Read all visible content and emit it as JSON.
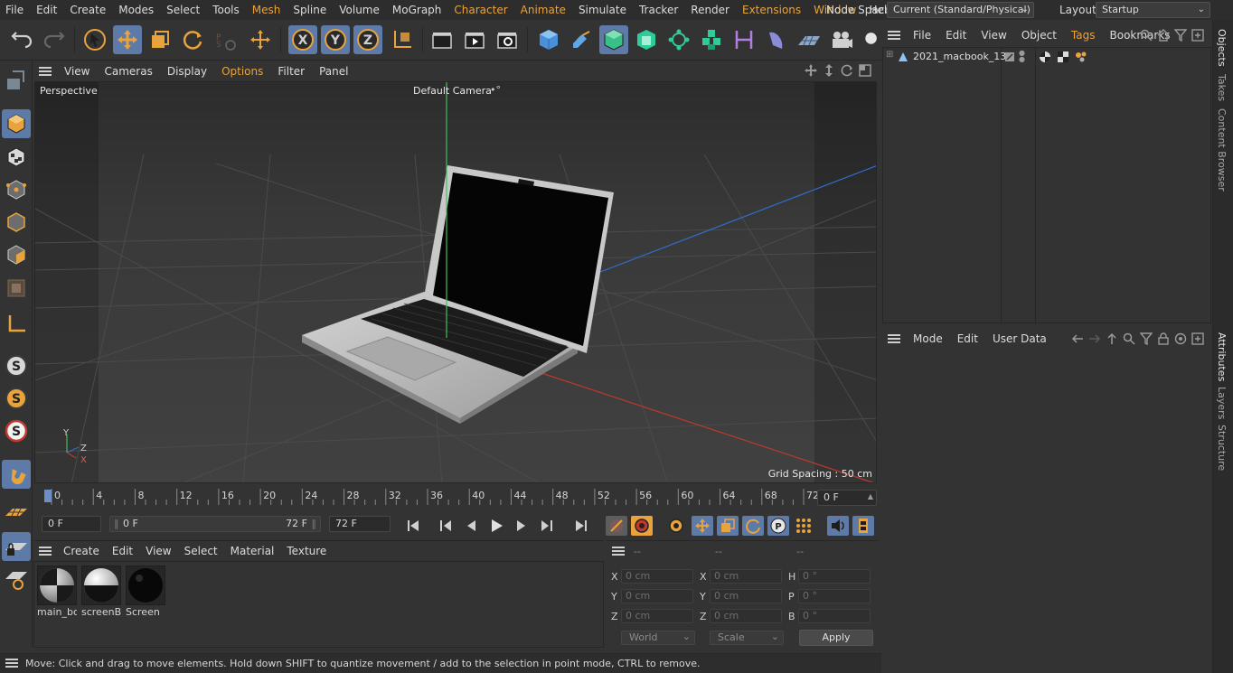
{
  "menu": {
    "items": [
      {
        "label": "File",
        "accent": false
      },
      {
        "label": "Edit",
        "accent": false
      },
      {
        "label": "Create",
        "accent": false
      },
      {
        "label": "Modes",
        "accent": false
      },
      {
        "label": "Select",
        "accent": false
      },
      {
        "label": "Tools",
        "accent": false
      },
      {
        "label": "Mesh",
        "accent": true
      },
      {
        "label": "Spline",
        "accent": false
      },
      {
        "label": "Volume",
        "accent": false
      },
      {
        "label": "MoGraph",
        "accent": false
      },
      {
        "label": "Character",
        "accent": true
      },
      {
        "label": "Animate",
        "accent": true
      },
      {
        "label": "Simulate",
        "accent": false
      },
      {
        "label": "Tracker",
        "accent": false
      },
      {
        "label": "Render",
        "accent": false
      },
      {
        "label": "Extensions",
        "accent": true
      },
      {
        "label": "Window",
        "accent": true
      },
      {
        "label": "Help",
        "accent": false
      }
    ],
    "node_space_label": "Node Space:",
    "node_space_value": "Current (Standard/Physical)",
    "layout_label": "Layout:",
    "layout_value": "Startup"
  },
  "viewport": {
    "menu": [
      {
        "label": "View",
        "accent": false
      },
      {
        "label": "Cameras",
        "accent": false
      },
      {
        "label": "Display",
        "accent": false
      },
      {
        "label": "Options",
        "accent": true
      },
      {
        "label": "Filter",
        "accent": false
      },
      {
        "label": "Panel",
        "accent": false
      }
    ],
    "projection": "Perspective",
    "camera": "Default Camera",
    "grid_spacing": "Grid Spacing : 50 cm",
    "axis_x": "X",
    "axis_y": "Y",
    "axis_z": "Z"
  },
  "timeline": {
    "ticks": [
      "0",
      "4",
      "8",
      "12",
      "16",
      "20",
      "24",
      "28",
      "32",
      "36",
      "40",
      "44",
      "48",
      "52",
      "56",
      "60",
      "64",
      "68",
      "72"
    ],
    "current_frame": "0 F",
    "start_field": "0 F",
    "range_start": "0 F",
    "range_end": "72 F",
    "end_field": "72 F"
  },
  "materials": {
    "menu": [
      "Create",
      "Edit",
      "View",
      "Select",
      "Material",
      "Texture"
    ],
    "items": [
      {
        "name": "main_bo"
      },
      {
        "name": "screenBc"
      },
      {
        "name": "Screen"
      }
    ]
  },
  "coords": {
    "headers": [
      "--",
      "--",
      "--"
    ],
    "rows": [
      {
        "l1": "X",
        "v1": "0 cm",
        "l2": "X",
        "v2": "0 cm",
        "l3": "H",
        "v3": "0 °"
      },
      {
        "l1": "Y",
        "v1": "0 cm",
        "l2": "Y",
        "v2": "0 cm",
        "l3": "P",
        "v3": "0 °"
      },
      {
        "l1": "Z",
        "v1": "0 cm",
        "l2": "Z",
        "v2": "0 cm",
        "l3": "B",
        "v3": "0 °"
      }
    ],
    "mode1": "World",
    "mode2": "Scale",
    "apply": "Apply"
  },
  "objects": {
    "menu": [
      {
        "label": "File",
        "accent": false
      },
      {
        "label": "Edit",
        "accent": false
      },
      {
        "label": "View",
        "accent": false
      },
      {
        "label": "Object",
        "accent": false
      },
      {
        "label": "Tags",
        "accent": true
      },
      {
        "label": "Bookmarks",
        "accent": false
      }
    ],
    "tree": [
      {
        "name": "2021_macbook_13"
      }
    ]
  },
  "attributes": {
    "menu": [
      "Mode",
      "Edit",
      "User Data"
    ]
  },
  "side_tabs": [
    {
      "label": "Objects",
      "active": true
    },
    {
      "label": "Takes",
      "active": false
    },
    {
      "label": "Content Browser",
      "active": false
    },
    {
      "label": "Attributes",
      "active": true
    },
    {
      "label": "Layers",
      "active": false
    },
    {
      "label": "Structure",
      "active": false
    }
  ],
  "status": {
    "text": "Move: Click and drag to move elements. Hold down SHIFT to quantize movement / add to the selection in point mode, CTRL to remove."
  },
  "colors": {
    "accent": "#e8a33d",
    "selected": "#5d7aa8",
    "axis_x": "#c0392b",
    "axis_y": "#3fbf5f",
    "axis_z": "#2f6fd0"
  }
}
